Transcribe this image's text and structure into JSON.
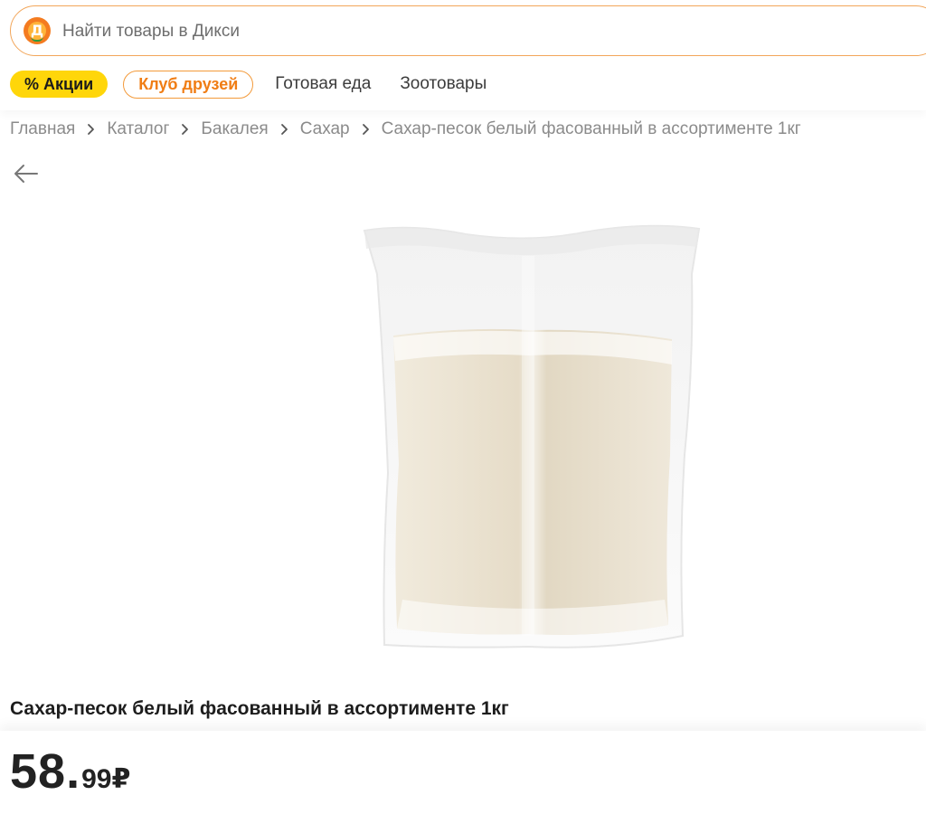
{
  "header": {
    "search_placeholder": "Найти товары в Дикси",
    "logo_letter": "Д"
  },
  "nav": {
    "sale_label": "% Акции",
    "club_label": "Клуб друзей",
    "links": [
      "Готовая еда",
      "Зоотовары"
    ]
  },
  "breadcrumb": [
    "Главная",
    "Каталог",
    "Бакалея",
    "Сахар",
    "Сахар-песок белый фасованный в ассортименте 1кг"
  ],
  "product": {
    "title": "Сахар-песок белый фасованный в ассортименте 1кг",
    "price_main": "58",
    "price_dot": ".",
    "price_cents": "99",
    "currency": "₽"
  },
  "icons": {
    "logo": "dixy-logo-icon",
    "back": "arrow-left-icon",
    "separator": "chevron-right-icon"
  },
  "colors": {
    "accent_orange": "#f47b20",
    "sale_yellow": "#ffd60a",
    "club_orange": "#f07d14"
  }
}
